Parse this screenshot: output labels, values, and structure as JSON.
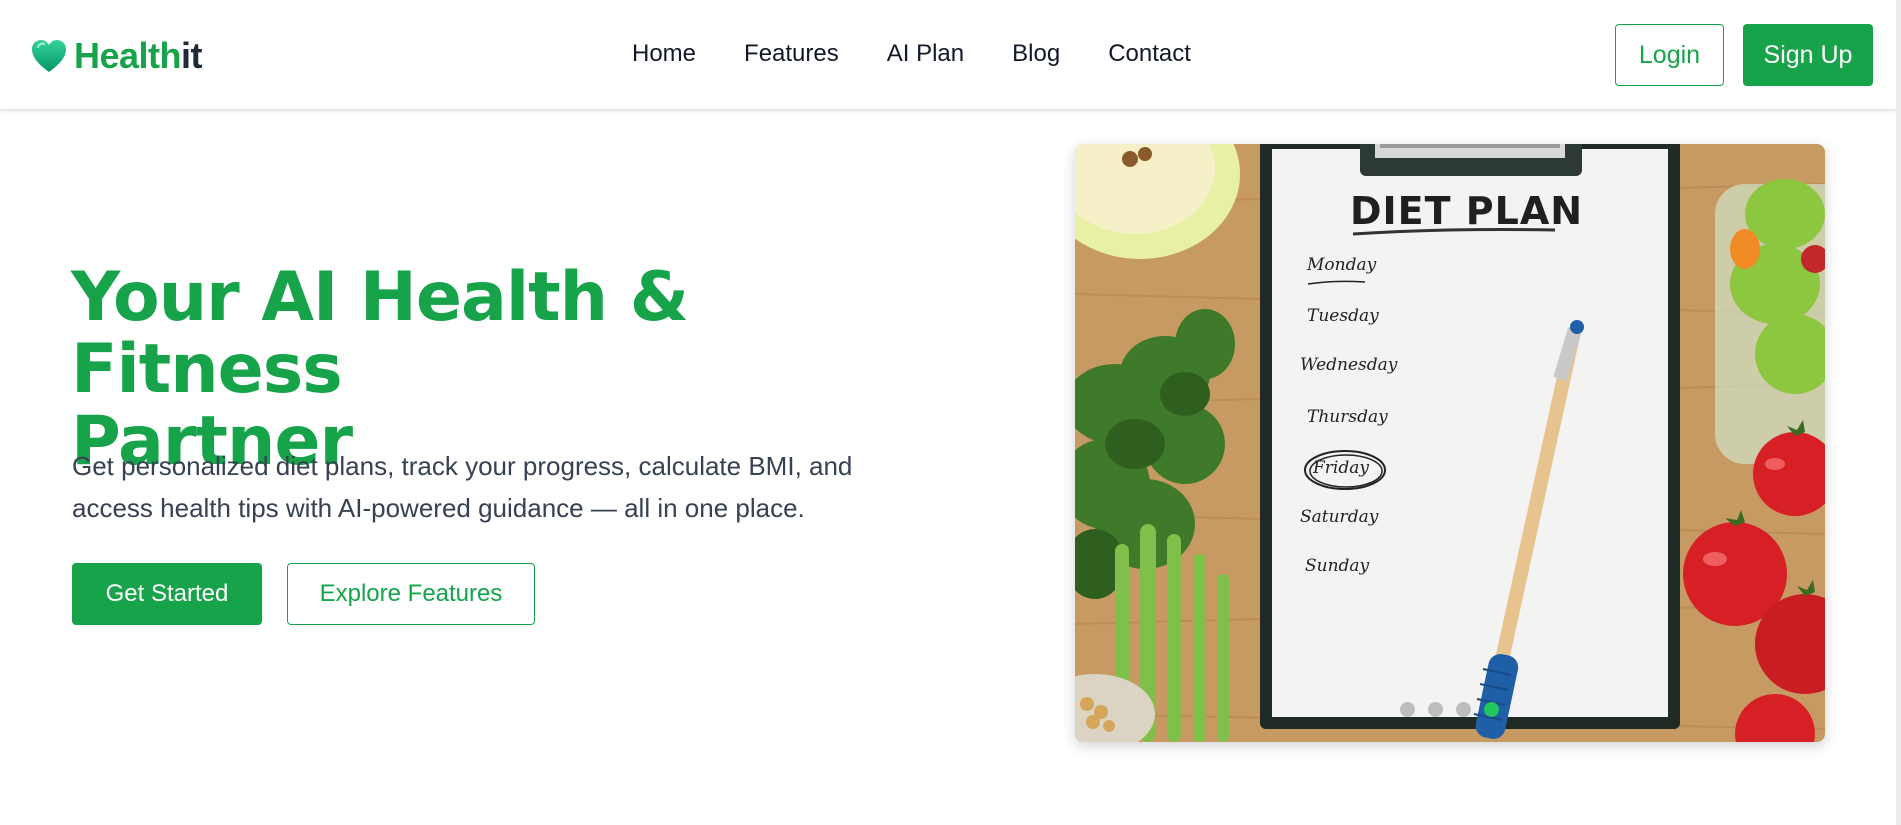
{
  "brand": {
    "name_part1": "Health",
    "name_part2": "it",
    "accent": "#16a34a"
  },
  "nav": {
    "items": [
      {
        "label": "Home"
      },
      {
        "label": "Features"
      },
      {
        "label": "AI Plan"
      },
      {
        "label": "Blog"
      },
      {
        "label": "Contact"
      }
    ],
    "login_label": "Login",
    "signup_label": "Sign Up"
  },
  "hero": {
    "title_line1": "Your AI Health & Fitness",
    "title_line2": "Partner",
    "subtitle_line1": "Get personalized diet plans, track your progress, calculate BMI, and",
    "subtitle_line2": "access health tips with AI-powered guidance — all in one place.",
    "primary_button": "Get Started",
    "secondary_button": "Explore Features"
  },
  "carousel": {
    "image_icon": "diet-plan-clipboard-photo",
    "clipboard_title": "DIET PLAN",
    "days": [
      "Monday",
      "Tuesday",
      "Wednesday",
      "Thursday",
      "Friday",
      "Saturday",
      "Sunday"
    ],
    "slide_count": 4,
    "active_slide": 4,
    "dot_color": "#bdbdbd",
    "active_dot_color": "#22c55e"
  }
}
